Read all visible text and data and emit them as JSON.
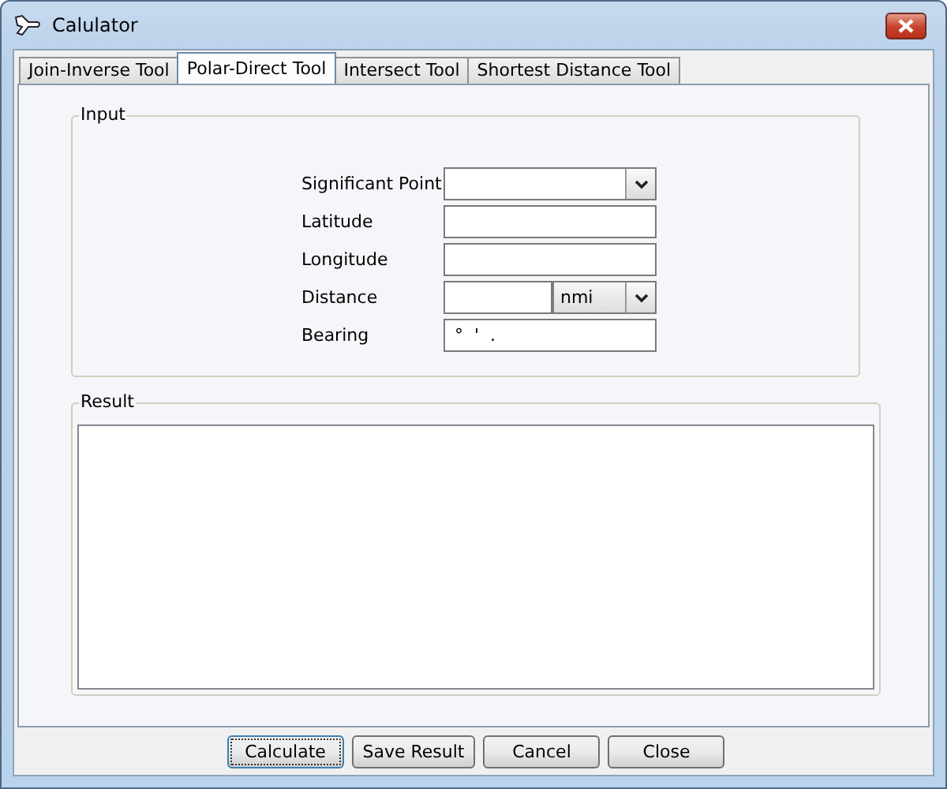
{
  "window": {
    "title": "Calulator"
  },
  "tabs": [
    {
      "label": "Join-Inverse Tool",
      "selected": false
    },
    {
      "label": "Polar-Direct Tool",
      "selected": true
    },
    {
      "label": "Intersect Tool",
      "selected": false
    },
    {
      "label": "Shortest Distance Tool",
      "selected": false
    }
  ],
  "input_group": {
    "legend": "Input",
    "fields": [
      {
        "kind": "select",
        "label": "Significant Point"
      },
      {
        "kind": "text",
        "label": "Latitude"
      },
      {
        "kind": "text",
        "label": "Longitude"
      },
      {
        "kind": "text_unit",
        "label": "Distance",
        "unit": "nmi"
      },
      {
        "kind": "text",
        "label": "Bearing",
        "value": "°  '  ."
      }
    ]
  },
  "result_group": {
    "legend": "Result"
  },
  "buttons": [
    {
      "label": "Calculate",
      "focused": true
    },
    {
      "label": "Save Result",
      "focused": false
    },
    {
      "label": "Cancel",
      "focused": false
    },
    {
      "label": "Close",
      "focused": false
    }
  ]
}
